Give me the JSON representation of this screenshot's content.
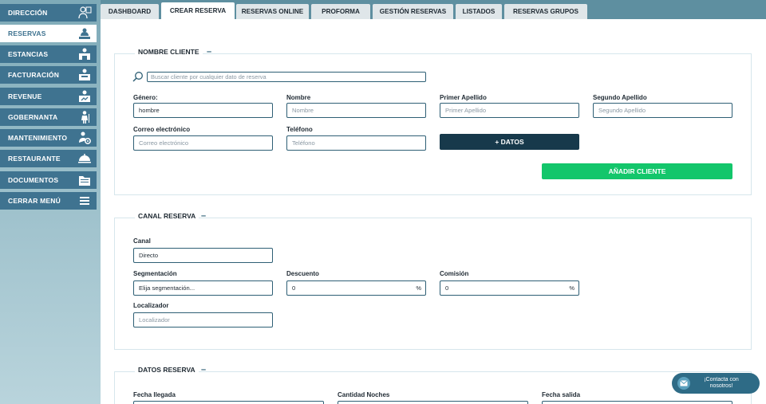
{
  "sidebar": {
    "items": [
      {
        "label": "DIRECCIÓN",
        "icon": "director-icon"
      },
      {
        "label": "RESERVAS",
        "icon": "reception-bell-icon"
      },
      {
        "label": "ESTANCIAS",
        "icon": "bed-icon"
      },
      {
        "label": "FACTURACIÓN",
        "icon": "invoice-icon"
      },
      {
        "label": "REVENUE",
        "icon": "revenue-icon"
      },
      {
        "label": "GOBERNANTA",
        "icon": "housekeeper-icon"
      },
      {
        "label": "MANTENIMIENTO",
        "icon": "maintenance-icon"
      },
      {
        "label": "RESTAURANTE",
        "icon": "cloche-icon"
      },
      {
        "label": "DOCUMENTOS",
        "icon": "folder-icon"
      },
      {
        "label": "CERRAR MENÚ",
        "icon": "menu-icon"
      }
    ],
    "active_index": 1
  },
  "tabs": [
    {
      "label": "DASHBOARD"
    },
    {
      "label": "CREAR RESERVA"
    },
    {
      "label": "RESERVAS ONLINE"
    },
    {
      "label": "PROFORMA"
    },
    {
      "label": "GESTIÓN RESERVAS"
    },
    {
      "label": "LISTADOS"
    },
    {
      "label": "RESERVAS GRUPOS"
    }
  ],
  "cliente": {
    "title": "NOMBRE CLIENTE",
    "toggle": "–",
    "search_placeholder": "Buscar cliente por cualquier dato de reserva",
    "genero_label": "Género:",
    "genero_value": "hombre",
    "nombre_label": "Nombre",
    "nombre_placeholder": "Nombre",
    "apellido1_label": "Primer Apellido",
    "apellido1_placeholder": "Primer Apellido",
    "apellido2_label": "Segundo Apellido",
    "apellido2_placeholder": "Segundo Apellido",
    "correo_label": "Correo electrónico",
    "correo_placeholder": "Correo electrónico",
    "telefono_label": "Teléfono",
    "telefono_placeholder": "Teléfono",
    "datos_button": "+ DATOS",
    "anadir_button": "AÑADIR CLIENTE"
  },
  "canal": {
    "title": "CANAL RESERVA",
    "toggle": "–",
    "canal_label": "Canal",
    "canal_value": "Directo",
    "segmentacion_label": "Segmentación",
    "segmentacion_placeholder": "Elija segmentación...",
    "descuento_label": "Descuento",
    "descuento_value": "0",
    "descuento_suffix": "%",
    "comision_label": "Comisión",
    "comision_value": "0",
    "comision_suffix": "%",
    "localizador_label": "Localizador",
    "localizador_placeholder": "Localizador"
  },
  "datos": {
    "title": "DATOS RESERVA",
    "toggle": "–",
    "llegada_label": "Fecha llegada",
    "noches_label": "Cantidad Noches",
    "salida_label": "Fecha salida"
  },
  "chat": {
    "line1": "¡Contacta con",
    "line2": "nosotros!"
  },
  "colors": {
    "sidebar_item": "#3f7390",
    "dark_button": "#17394b",
    "green_button": "#13c66b",
    "input_border": "#2e5f75"
  }
}
